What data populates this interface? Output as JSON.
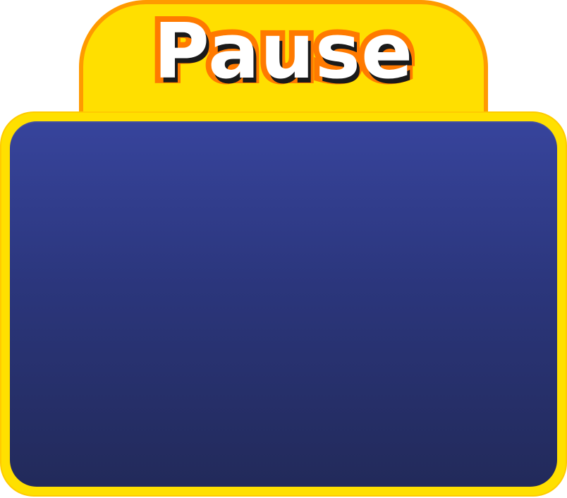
{
  "pause_menu": {
    "title": "Pause"
  },
  "colors": {
    "title_tab_fill": "#ffdf00",
    "title_tab_border": "#ff9a00",
    "title_text_fill": "#ffffff",
    "title_text_outline": "#ff7a00",
    "panel_border": "#ffe000",
    "panel_gradient_top": "#37449c",
    "panel_gradient_bottom": "#222a5a"
  }
}
